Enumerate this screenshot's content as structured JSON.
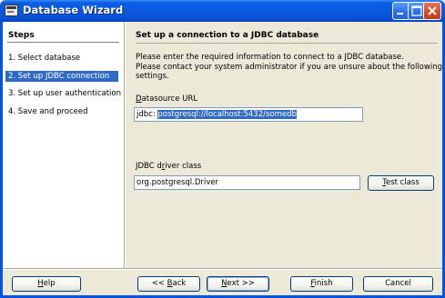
{
  "window": {
    "title": "Database Wizard"
  },
  "steps": {
    "heading": "Steps",
    "items": [
      {
        "label": "1.  Select database",
        "active": false
      },
      {
        "label": "2.  Set up JDBC connection",
        "active": true
      },
      {
        "label": "3.  Set up user authentication",
        "active": false
      },
      {
        "label": "4.  Save and proceed",
        "active": false
      }
    ]
  },
  "content": {
    "title": "Set up a connection to a JDBC database",
    "description_lines": [
      "Please enter the required information to connect to a JDBC database.",
      "Please contact your system administrator if you are unsure about the following",
      "settings."
    ],
    "datasource": {
      "label_pre": "",
      "label_mnemonic": "D",
      "label_post": "atasource URL",
      "prefix": "jdbc:",
      "value": "postgresql://localhost:5432/somedb"
    },
    "driver": {
      "label_pre": "JDBC d",
      "label_mnemonic": "r",
      "label_post": "iver class",
      "value": "org.postgresql.Driver",
      "test_pre": "",
      "test_mnemonic": "T",
      "test_post": "est class"
    }
  },
  "footer": {
    "help": {
      "pre": "",
      "mn": "H",
      "post": "elp"
    },
    "back": {
      "pre": "<< ",
      "mn": "B",
      "post": "ack"
    },
    "next": {
      "pre": "",
      "mn": "N",
      "post": "ext >>"
    },
    "finish": {
      "pre": "",
      "mn": "F",
      "post": "inish"
    },
    "cancel": {
      "pre": "Cancel",
      "mn": "",
      "post": ""
    }
  },
  "icons": [
    "app-icon",
    "minimize-icon",
    "maximize-icon",
    "close-icon"
  ],
  "colors": {
    "titlebar": "#0a58e0",
    "selection": "#316ac5",
    "face": "#ece9d8"
  }
}
